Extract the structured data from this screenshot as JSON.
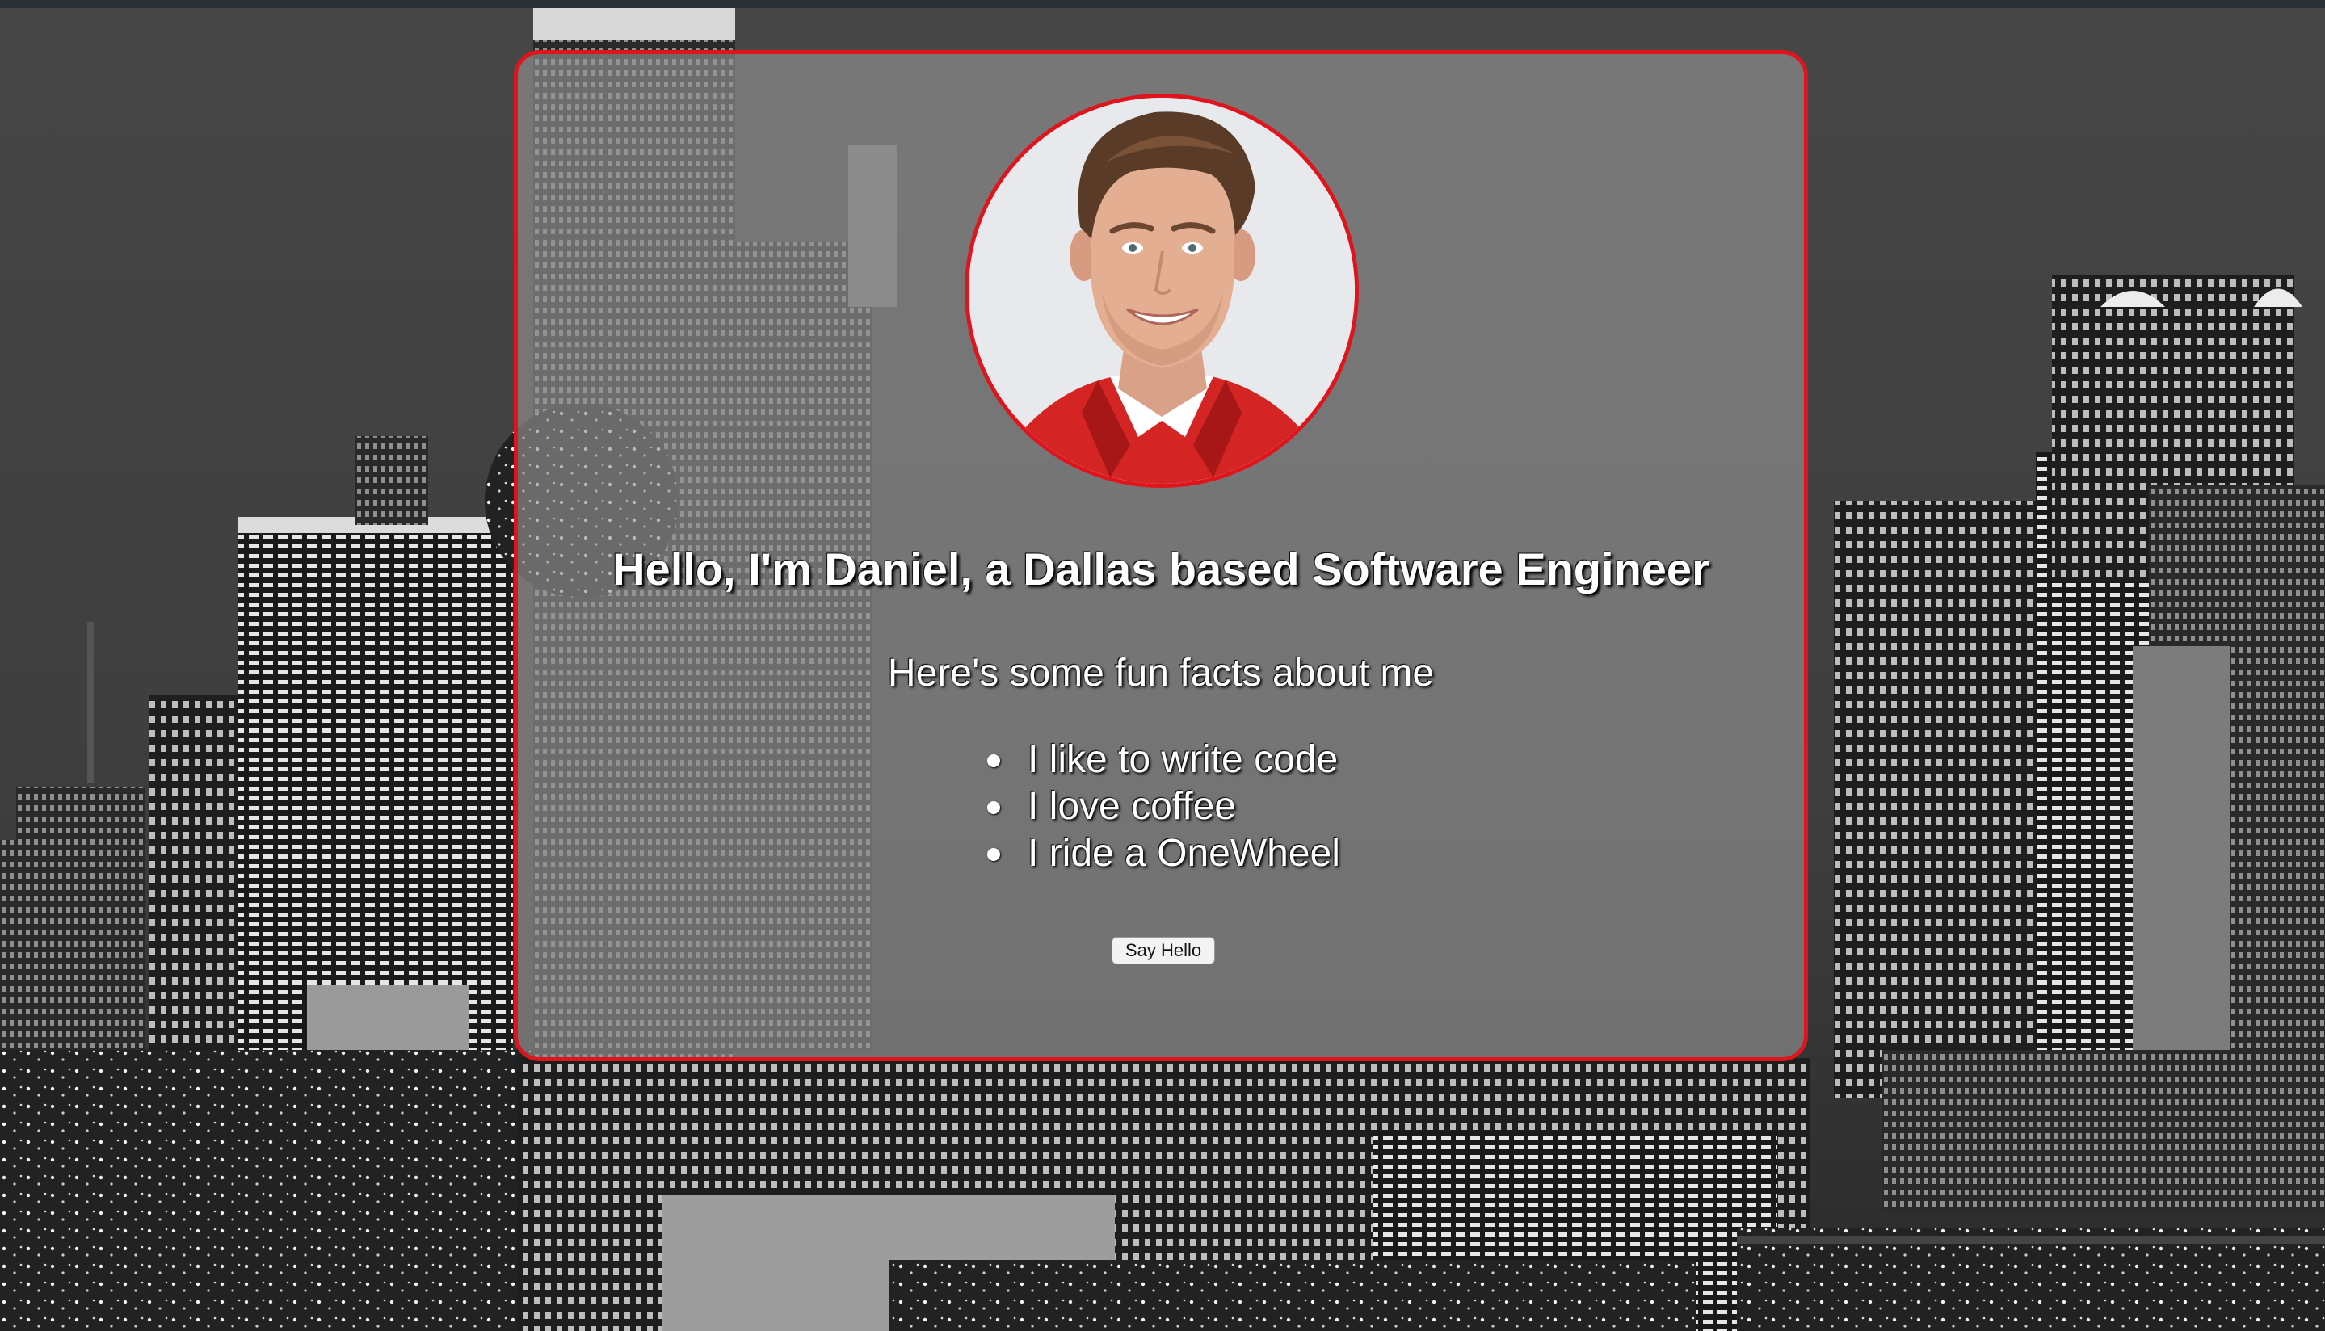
{
  "profile": {
    "photo_alt": "Daniel profile photo",
    "headline": "Hello, I'm Daniel, a Dallas based Software Engineer",
    "subheading": "Here's some fun facts about me",
    "facts": [
      "I like to write code",
      "I love coffee",
      "I ride a OneWheel"
    ],
    "button_label": "Say Hello"
  },
  "colors": {
    "accent": "#e0141c",
    "text": "#ffffff",
    "card_background": "rgba(150,150,150,0.62)"
  },
  "background": {
    "description_icon": "city-skyline-image"
  }
}
